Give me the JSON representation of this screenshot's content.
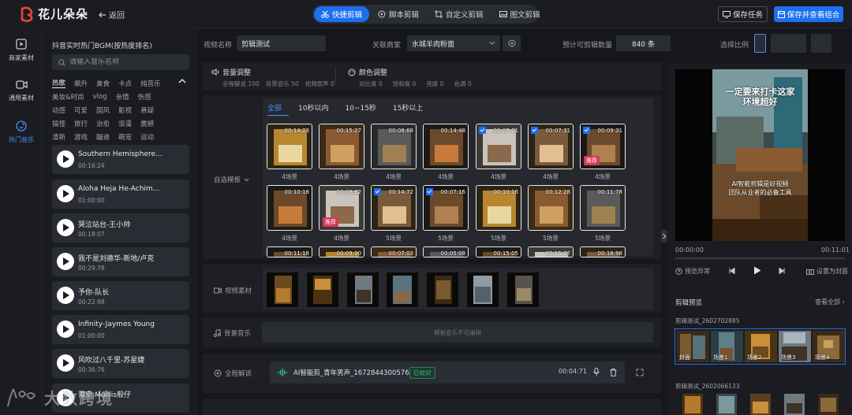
{
  "app": {
    "name": "花儿朵朵",
    "back_label": "返回",
    "brand_color": "#e8483c",
    "accent_color": "#1e6ff0"
  },
  "modes": [
    {
      "label": "快捷剪辑",
      "icon": "scissors-icon",
      "active": true
    },
    {
      "label": "脚本剪辑",
      "icon": "film-icon",
      "active": false
    },
    {
      "label": "自定义剪辑",
      "icon": "crop-icon",
      "active": false
    },
    {
      "label": "图文剪辑",
      "icon": "image-icon",
      "active": false
    }
  ],
  "actions": {
    "save_task": "保存任务",
    "save_view": "保存并查看组合"
  },
  "leftnav": [
    {
      "label": "商家素材",
      "icon": "play-square-icon",
      "active": false
    },
    {
      "label": "通用素材",
      "icon": "video-camera-icon",
      "active": false
    },
    {
      "label": "热门音乐",
      "icon": "music-disc-icon",
      "active": true
    }
  ],
  "music": {
    "title": "抖音实时热门BGM(按热度排名)",
    "search_placeholder": "请输入音乐名称",
    "tag_rows": [
      [
        "热歌",
        "飙升",
        "美食",
        "卡点",
        "纯音乐"
      ],
      [
        "美妆&时尚",
        "vlog",
        "亲情",
        "伤感"
      ],
      [
        "动感",
        "可爱",
        "国风",
        "影视",
        "悬疑"
      ],
      [
        "搞怪",
        "旅行",
        "治愈",
        "浪漫",
        "震撼"
      ],
      [
        "清新",
        "游戏",
        "蹦迪",
        "萌宠",
        "运动"
      ]
    ],
    "tracks": [
      {
        "name": "Southern Hemisphere...",
        "duration": "00:16:24"
      },
      {
        "name": "Aloha Heja He-Achim...",
        "duration": "01:00:00"
      },
      {
        "name": "哭泣站台-王小帅",
        "duration": "00:18:07"
      },
      {
        "name": "我不是刘德华-新地/卢克",
        "duration": "00:29:78"
      },
      {
        "name": "予你-队长",
        "duration": "00:22:98"
      },
      {
        "name": "Infinity-Jaymes Young",
        "duration": "01:00:00"
      },
      {
        "name": "风吹过八千里-苏星婕",
        "duration": "00:36:76"
      },
      {
        "name": "落空-Morris般仔",
        "duration": ""
      }
    ]
  },
  "form": {
    "video_name_label": "视频名称",
    "video_name_value": "剪辑测试",
    "merchant_label": "关联商家",
    "merchant_value": "水城羊肉粉面",
    "estimate_label": "预计可剪辑数量",
    "estimate_value": "840 条",
    "ratio_label": "选择比例"
  },
  "adjust": {
    "volume_title": "音量调整",
    "volume_values": [
      "全程解说 100",
      "背景音乐 50",
      "视频原声 0"
    ],
    "color_title": "颜色调整",
    "color_values": [
      "对比度 0",
      "饱和度 0",
      "亮度 0",
      "色调 0"
    ]
  },
  "templates": {
    "side_label": "自选模板",
    "tabs": [
      "全部",
      "10秒以内",
      "10~15秒",
      "15秒以上"
    ],
    "rows": [
      [
        {
          "time": "00:14:23",
          "caption": "4场景",
          "checked": false,
          "badge": ""
        },
        {
          "time": "00:15:27",
          "caption": "4场景",
          "checked": false,
          "badge": ""
        },
        {
          "time": "00:08:68",
          "caption": "4场景",
          "checked": false,
          "badge": ""
        },
        {
          "time": "00:14:48",
          "caption": "4场景",
          "checked": false,
          "badge": ""
        },
        {
          "time": "00:07:01",
          "caption": "4场景",
          "checked": true,
          "badge": ""
        },
        {
          "time": "00:07:31",
          "caption": "4场景",
          "checked": true,
          "badge": ""
        },
        {
          "time": "00:09:31",
          "caption": "4场景",
          "checked": true,
          "badge": "推荐"
        }
      ],
      [
        {
          "time": "00:10:18",
          "caption": "4场景",
          "checked": false,
          "badge": ""
        },
        {
          "time": "00:08:62",
          "caption": "4场景",
          "checked": false,
          "badge": "推荐"
        },
        {
          "time": "00:14:72",
          "caption": "5场景",
          "checked": true,
          "badge": ""
        },
        {
          "time": "00:07:16",
          "caption": "5场景",
          "checked": true,
          "badge": ""
        },
        {
          "time": "00:10:16",
          "caption": "5场景",
          "checked": false,
          "badge": ""
        },
        {
          "time": "00:12:28",
          "caption": "5场景",
          "checked": false,
          "badge": ""
        },
        {
          "time": "00:11:78",
          "caption": "5场景",
          "checked": false,
          "badge": ""
        }
      ],
      [
        {
          "time": "00:11:18",
          "caption": "",
          "checked": false,
          "badge": ""
        },
        {
          "time": "00:09:90",
          "caption": "",
          "checked": false,
          "badge": ""
        },
        {
          "time": "00:07:03",
          "caption": "",
          "checked": false,
          "badge": ""
        },
        {
          "time": "00:05:08",
          "caption": "",
          "checked": false,
          "badge": ""
        },
        {
          "time": "00:15:05",
          "caption": "",
          "checked": false,
          "badge": ""
        },
        {
          "time": "00:15:27",
          "caption": "",
          "checked": false,
          "badge": ""
        },
        {
          "time": "00:18:98",
          "caption": "",
          "checked": false,
          "badge": ""
        }
      ]
    ]
  },
  "materials": {
    "side_label": "视频素材"
  },
  "bgm": {
    "side_label": "背景音乐",
    "placeholder": "模板音乐不可编辑"
  },
  "narration": {
    "side_label": "全程解说",
    "file_name": "AI智能剪_青年男声_1672844300576.MP3",
    "status": "已校对",
    "duration": "00:04:71"
  },
  "preview": {
    "video_text_line1": "一定要来打卡这家",
    "video_text_line2": "环境超好",
    "video_caption_line1": "AI智能剪辑是好视频",
    "video_caption_line2": "团队从业者的必备工具",
    "time_current": "00:00:00",
    "time_total": "00:11:01",
    "anomaly_label": "预览异常",
    "cover_label": "设置为封面",
    "section_title": "剪辑预览",
    "view_all": "查看全部",
    "group1_name": "剪辑测试_2602702885",
    "group1_frames": [
      "封面",
      "场景1",
      "场景2",
      "场景3",
      "场景4"
    ],
    "group2_name": "剪辑测试_2602066133"
  },
  "watermark": {
    "text": "大数跨境"
  }
}
